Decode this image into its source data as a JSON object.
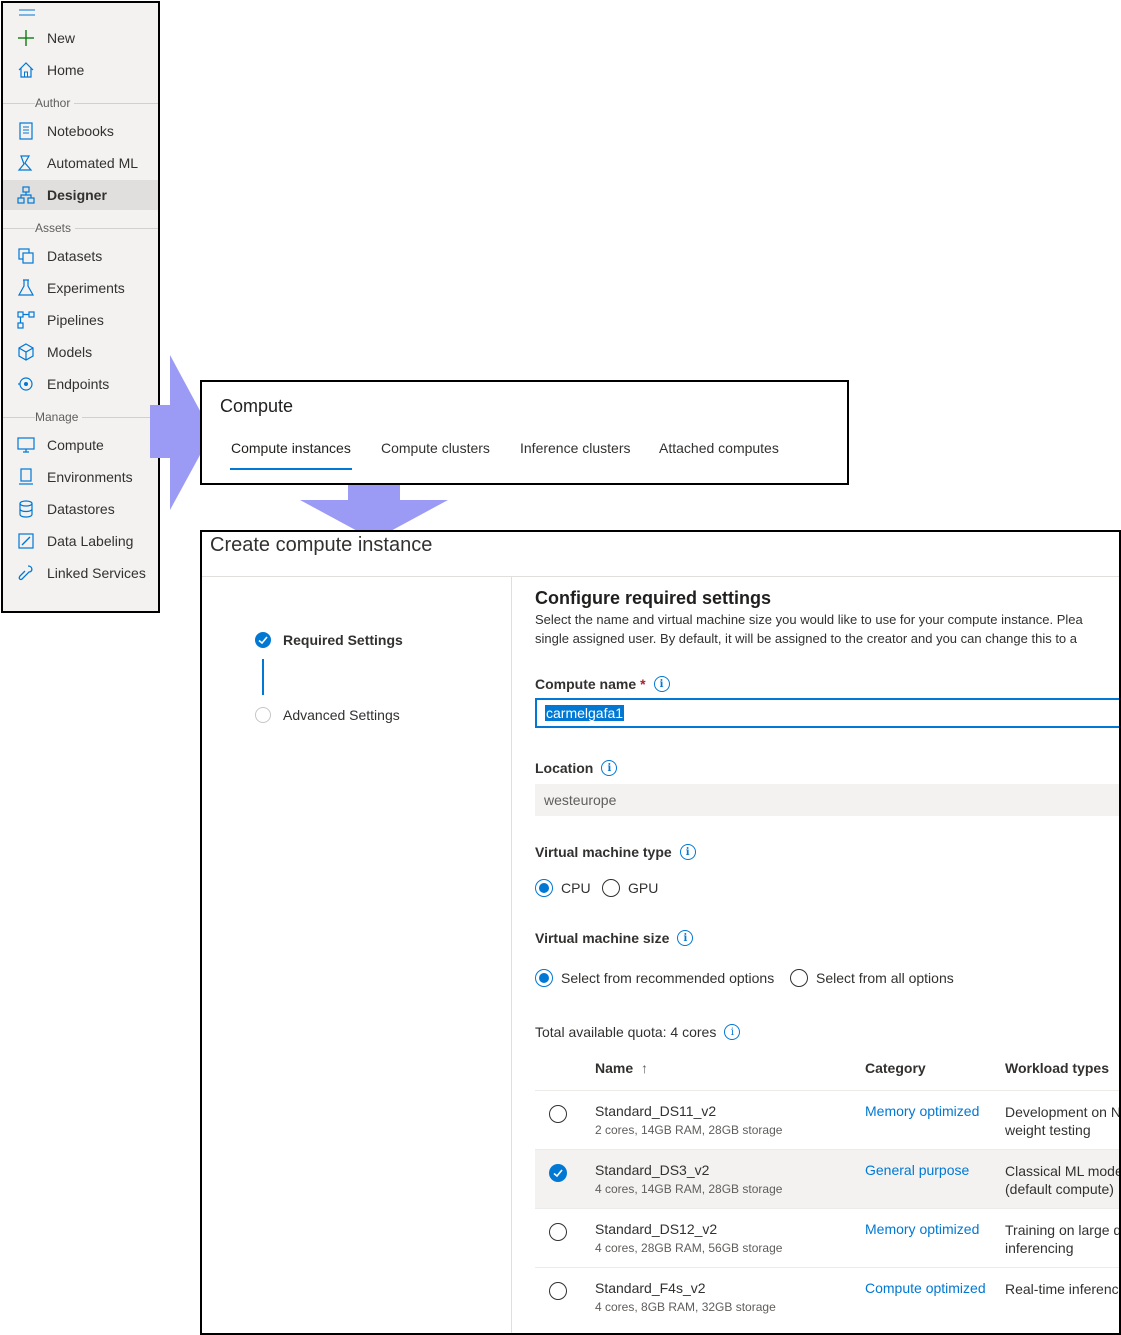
{
  "sidebar": {
    "items": [
      {
        "label": "New",
        "icon": "plus-icon"
      },
      {
        "label": "Home",
        "icon": "home-icon"
      },
      {
        "label": "Notebooks",
        "icon": "notebook-icon"
      },
      {
        "label": "Automated ML",
        "icon": "automl-icon"
      },
      {
        "label": "Designer",
        "icon": "designer-icon"
      },
      {
        "label": "Datasets",
        "icon": "datasets-icon"
      },
      {
        "label": "Experiments",
        "icon": "flask-icon"
      },
      {
        "label": "Pipelines",
        "icon": "pipelines-icon"
      },
      {
        "label": "Models",
        "icon": "cube-icon"
      },
      {
        "label": "Endpoints",
        "icon": "endpoints-icon"
      },
      {
        "label": "Compute",
        "icon": "monitor-icon"
      },
      {
        "label": "Environments",
        "icon": "environments-icon"
      },
      {
        "label": "Datastores",
        "icon": "database-icon"
      },
      {
        "label": "Data Labeling",
        "icon": "labeling-icon"
      },
      {
        "label": "Linked Services",
        "icon": "link-icon"
      }
    ],
    "sections": {
      "author": "Author",
      "assets": "Assets",
      "manage": "Manage"
    },
    "selected": "Designer"
  },
  "compute": {
    "title": "Compute",
    "tabs": [
      "Compute instances",
      "Compute clusters",
      "Inference clusters",
      "Attached computes"
    ],
    "active_tab": "Compute instances"
  },
  "create": {
    "title": "Create compute instance",
    "steps": [
      "Required Settings",
      "Advanced Settings"
    ],
    "heading": "Configure required settings",
    "description_line1": "Select the name and virtual machine size you would like to use for your compute instance. Plea",
    "description_line2": "single assigned user. By default, it will be assigned to the creator and you can change this to a",
    "compute_name_label": "Compute name",
    "required_mark": "*",
    "compute_name_value": "carmelgafa1",
    "location_label": "Location",
    "location_value": "westeurope",
    "vm_type_label": "Virtual machine type",
    "vm_type_options": [
      "CPU",
      "GPU"
    ],
    "vm_type_selected": "CPU",
    "vm_size_label": "Virtual machine size",
    "vm_size_options": [
      "Select from recommended options",
      "Select from all options"
    ],
    "vm_size_selected": "Select from recommended options",
    "quota_label": "Total available quota: 4 cores",
    "table": {
      "headers": {
        "name": "Name",
        "sort_icon": "↑",
        "category": "Category",
        "workload": "Workload types"
      },
      "rows": [
        {
          "name": "Standard_DS11_v2",
          "spec": "2 cores, 14GB RAM, 28GB storage",
          "category": "Memory optimized",
          "workload1": "Development on N",
          "workload2": "weight testing",
          "selected": false
        },
        {
          "name": "Standard_DS3_v2",
          "spec": "4 cores, 14GB RAM, 28GB storage",
          "category": "General purpose",
          "workload1": "Classical ML model",
          "workload2": "(default compute)",
          "selected": true
        },
        {
          "name": "Standard_DS12_v2",
          "spec": "4 cores, 28GB RAM, 56GB storage",
          "category": "Memory optimized",
          "workload1": "Training on large d",
          "workload2": "inferencing",
          "selected": false
        },
        {
          "name": "Standard_F4s_v2",
          "spec": "4 cores, 8GB RAM, 32GB storage",
          "category": "Compute optimized",
          "workload1": "Real-time inferenci",
          "workload2": "",
          "selected": false
        }
      ]
    }
  },
  "colors": {
    "accent": "#0078d4",
    "arrow": "#9b9bf5",
    "required": "#a4262c",
    "add": "#107c10"
  }
}
